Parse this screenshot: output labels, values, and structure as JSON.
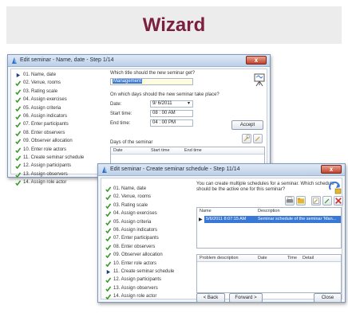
{
  "banner": {
    "title": "Wizard"
  },
  "window1": {
    "title": "Edit seminar - Name, date - Step 1/14",
    "close_label": "x",
    "steps": [
      {
        "label": "01. Name, date",
        "state": "current"
      },
      {
        "label": "02. Venue, rooms",
        "state": "done"
      },
      {
        "label": "03. Rating scale",
        "state": "done"
      },
      {
        "label": "04. Assign exercises",
        "state": "done"
      },
      {
        "label": "05. Assign criteria",
        "state": "done"
      },
      {
        "label": "06. Assign indicators",
        "state": "done"
      },
      {
        "label": "07. Enter participants",
        "state": "done"
      },
      {
        "label": "08. Enter observers",
        "state": "done"
      },
      {
        "label": "09. Observer allocation",
        "state": "done"
      },
      {
        "label": "10. Enter role actors",
        "state": "done"
      },
      {
        "label": "11. Create seminar schedule",
        "state": "done"
      },
      {
        "label": "12. Assign participants",
        "state": "done"
      },
      {
        "label": "13. Assign observers",
        "state": "done"
      },
      {
        "label": "14. Assign role actor",
        "state": "done"
      }
    ],
    "title_question": "Which title should the new seminar get?",
    "title_value": "Management",
    "days_question": "On which days should the new seminar take place?",
    "date_label": "Date:",
    "date_value": "9/ 6/2011",
    "start_label": "Start time:",
    "start_value": "08 : 00   AM",
    "end_label": "End time:",
    "end_value": "04 : 00   PM",
    "accept_label": "Accept",
    "days_heading": "Days of the seminar",
    "days_columns": [
      "Date",
      "Start time",
      "End time"
    ]
  },
  "window2": {
    "title": "Edit seminar - Create seminar schedule - Step 11/14",
    "close_label": "x",
    "steps": [
      {
        "label": "01. Name, date",
        "state": "done"
      },
      {
        "label": "02. Venue, rooms",
        "state": "done"
      },
      {
        "label": "03. Rating scale",
        "state": "done"
      },
      {
        "label": "04. Assign exercises",
        "state": "done"
      },
      {
        "label": "05. Assign criteria",
        "state": "done"
      },
      {
        "label": "06. Assign indicators",
        "state": "done"
      },
      {
        "label": "07. Enter participants",
        "state": "done"
      },
      {
        "label": "08. Enter observers",
        "state": "done"
      },
      {
        "label": "09. Observer allocation",
        "state": "done"
      },
      {
        "label": "10. Enter role actors",
        "state": "done"
      },
      {
        "label": "11. Create seminar schedule",
        "state": "current"
      },
      {
        "label": "12. Assign participants",
        "state": "done"
      },
      {
        "label": "13. Assign observers",
        "state": "done"
      },
      {
        "label": "14. Assign role actor",
        "state": "done"
      }
    ],
    "info_line1": "You can create multiple schedules for a seminar. Which schedule",
    "info_line2": "should be the active one for this seminar?",
    "schedule_columns": [
      "Name",
      "Description"
    ],
    "schedule_row": {
      "name": "5/6/2011 8:07:15 AM",
      "description": "Seminar schedule of the seminar 'Man..."
    },
    "problem_columns": [
      "Problem description",
      "Date",
      "Time",
      "Detail"
    ],
    "back_label": "< Back",
    "forward_label": "Forward >",
    "close_button_label": "Close"
  },
  "colors": {
    "banner_title": "#7b2040",
    "check_green": "#3a9a2a",
    "selection": "#3a78d6"
  },
  "icons": [
    "app-icon",
    "check-icon",
    "current-step-arrow-icon",
    "flipchart-icon",
    "edit-icon",
    "delete-icon",
    "folder-icon",
    "dropdown-icon"
  ]
}
